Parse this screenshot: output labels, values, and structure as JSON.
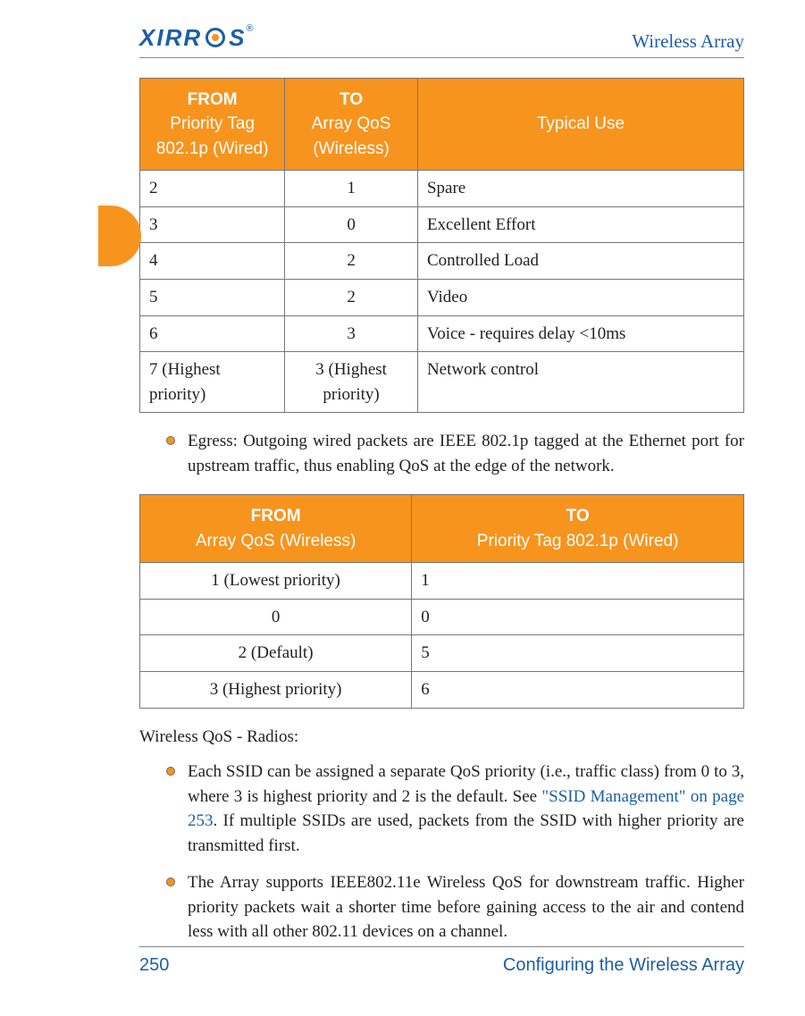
{
  "header": {
    "logo_left": "XIRR",
    "logo_right": "S",
    "logo_reg": "®",
    "title": "Wireless Array"
  },
  "table1": {
    "headers": {
      "from_strong": "FROM",
      "from_sub": "Priority Tag 802.1p (Wired)",
      "to_strong": "TO",
      "to_sub": "Array QoS (Wireless)",
      "use": "Typical Use"
    },
    "rows": [
      {
        "from": "2",
        "to": "1",
        "use": "Spare"
      },
      {
        "from": "3",
        "to": "0",
        "use": "Excellent Effort"
      },
      {
        "from": "4",
        "to": "2",
        "use": "Controlled Load"
      },
      {
        "from": "5",
        "to": "2",
        "use": "Video"
      },
      {
        "from": "6",
        "to": "3",
        "use": "Voice - requires delay <10ms"
      },
      {
        "from": "7 (Highest priority)",
        "to": "3 (Highest priority)",
        "use": "Network control"
      }
    ]
  },
  "bullet_egress": "Egress: Outgoing wired packets are IEEE 802.1p tagged at the Ethernet port for upstream traffic, thus enabling QoS at the edge of the network.",
  "table2": {
    "headers": {
      "from_strong": "FROM",
      "from_sub": "Array QoS (Wireless)",
      "to_strong": "TO",
      "to_sub": "Priority Tag 802.1p (Wired)"
    },
    "rows": [
      {
        "from": "1 (Lowest priority)",
        "to": "1"
      },
      {
        "from": "0",
        "to": "0"
      },
      {
        "from": "2 (Default)",
        "to": "5"
      },
      {
        "from": "3 (Highest priority)",
        "to": "6"
      }
    ]
  },
  "section_label": "Wireless QoS - Radios:",
  "bullet_ssid_pre": "Each SSID can be assigned a separate QoS priority (i.e., traffic class) from 0 to 3, where 3 is highest priority and 2 is the default. See ",
  "bullet_ssid_link": "\"SSID Management\" on page 253",
  "bullet_ssid_post": ". If multiple SSIDs are used, packets from the SSID with higher priority are transmitted first.",
  "bullet_80211e": "The Array supports IEEE802.11e Wireless QoS for downstream traffic. Higher priority packets wait a shorter time before gaining access to the air and contend less with all other 802.11 devices on a channel.",
  "footer": {
    "page": "250",
    "title": "Configuring the Wireless Array"
  }
}
